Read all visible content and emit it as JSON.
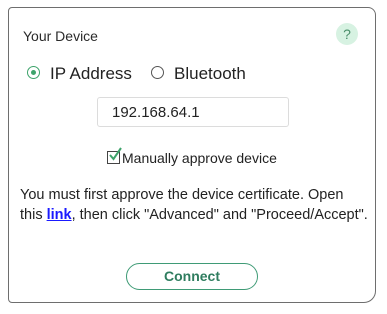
{
  "panel": {
    "title": "Your Device",
    "help_icon": "?"
  },
  "connection_type": {
    "options": [
      {
        "label": "IP Address",
        "selected": true
      },
      {
        "label": "Bluetooth",
        "selected": false
      }
    ]
  },
  "ip_field": {
    "value": "192.168.64.1"
  },
  "manual_approve": {
    "label": "Manually approve device",
    "checked": true
  },
  "instructions": {
    "before_link": "You must first approve the device certificate. Open this ",
    "link_text": "link",
    "after_link": ", then click \"Advanced\" and \"Proceed/Accept\"."
  },
  "connect_button": {
    "label": "Connect"
  },
  "colors": {
    "accent": "#3ea36b",
    "help_bg": "#d7f2e2",
    "link": "#1a1aff",
    "button_border": "#3f9b76"
  }
}
